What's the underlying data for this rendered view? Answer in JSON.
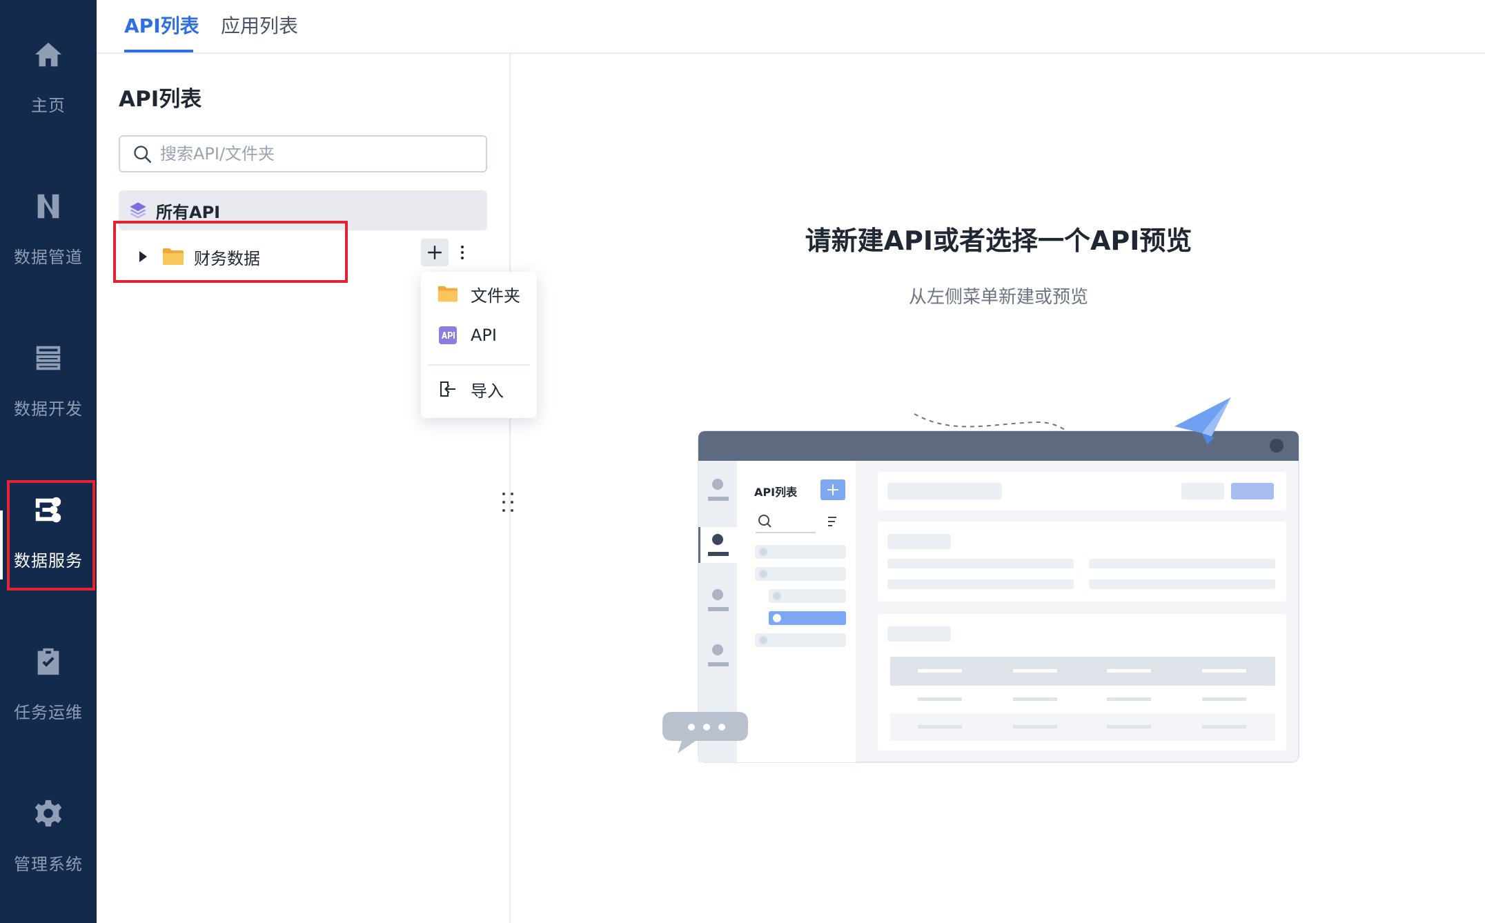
{
  "nav": {
    "items": [
      {
        "label": "主页",
        "icon": "home-icon"
      },
      {
        "label": "数据管道",
        "icon": "pipeline-icon"
      },
      {
        "label": "数据开发",
        "icon": "database-icon"
      },
      {
        "label": "数据服务",
        "icon": "data-service-icon",
        "active": true
      },
      {
        "label": "任务运维",
        "icon": "clipboard-check-icon"
      },
      {
        "label": "管理系统",
        "icon": "gear-icon"
      }
    ]
  },
  "tabs": [
    {
      "label": "API列表",
      "active": true
    },
    {
      "label": "应用列表",
      "active": false
    }
  ],
  "panel": {
    "title": "API列表",
    "search_placeholder": "搜索API/文件夹",
    "search_value": "",
    "all_api_label": "所有API",
    "folders": [
      {
        "name": "财务数据",
        "expanded": false
      }
    ]
  },
  "add_menu": {
    "items": [
      {
        "label": "文件夹",
        "icon": "folder-icon"
      },
      {
        "label": "API",
        "icon": "api-icon"
      },
      {
        "label": "导入",
        "icon": "import-icon"
      }
    ]
  },
  "empty_state": {
    "title": "请新建API或者选择一个API预览",
    "subtitle": "从左侧菜单新建或预览",
    "illustration_label": "API列表"
  },
  "colors": {
    "nav_bg": "#142a4d",
    "accent": "#2f6fe4",
    "highlight": "#e52330",
    "folder": "#f5b93e",
    "api_icon": "#8c7ee0"
  }
}
